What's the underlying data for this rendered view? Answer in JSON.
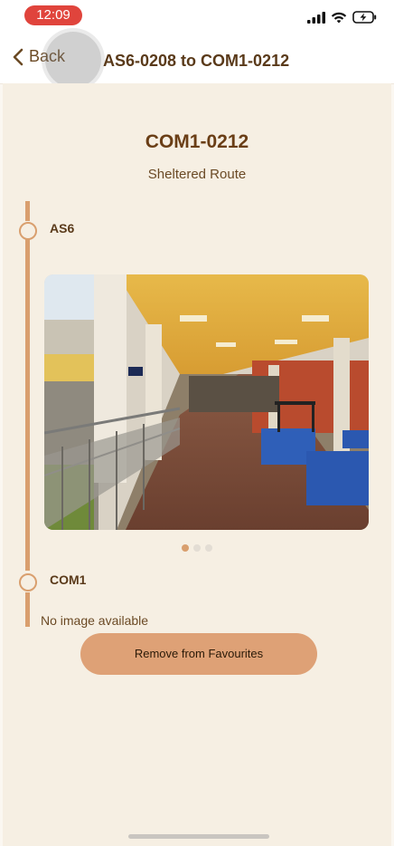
{
  "status": {
    "time": "12:09",
    "icons": [
      "signal-icon",
      "wifi-icon",
      "battery-charging-icon"
    ]
  },
  "nav": {
    "back_label": "Back",
    "title": "AS6-0208 to COM1-0212"
  },
  "route": {
    "destination": "COM1-0212",
    "route_type": "Sheltered Route",
    "stops": [
      {
        "name": "AS6",
        "image": "sheltered-walkway-photo"
      },
      {
        "name": "COM1",
        "image_note": "No image available"
      }
    ]
  },
  "carousel": {
    "pages": 3,
    "active": 1
  },
  "actions": {
    "remove_label": "Remove from Favourites"
  },
  "colors": {
    "accent": "#d99f6e",
    "button": "#dea176",
    "text": "#5a3a1a",
    "background": "#f6efe3"
  }
}
